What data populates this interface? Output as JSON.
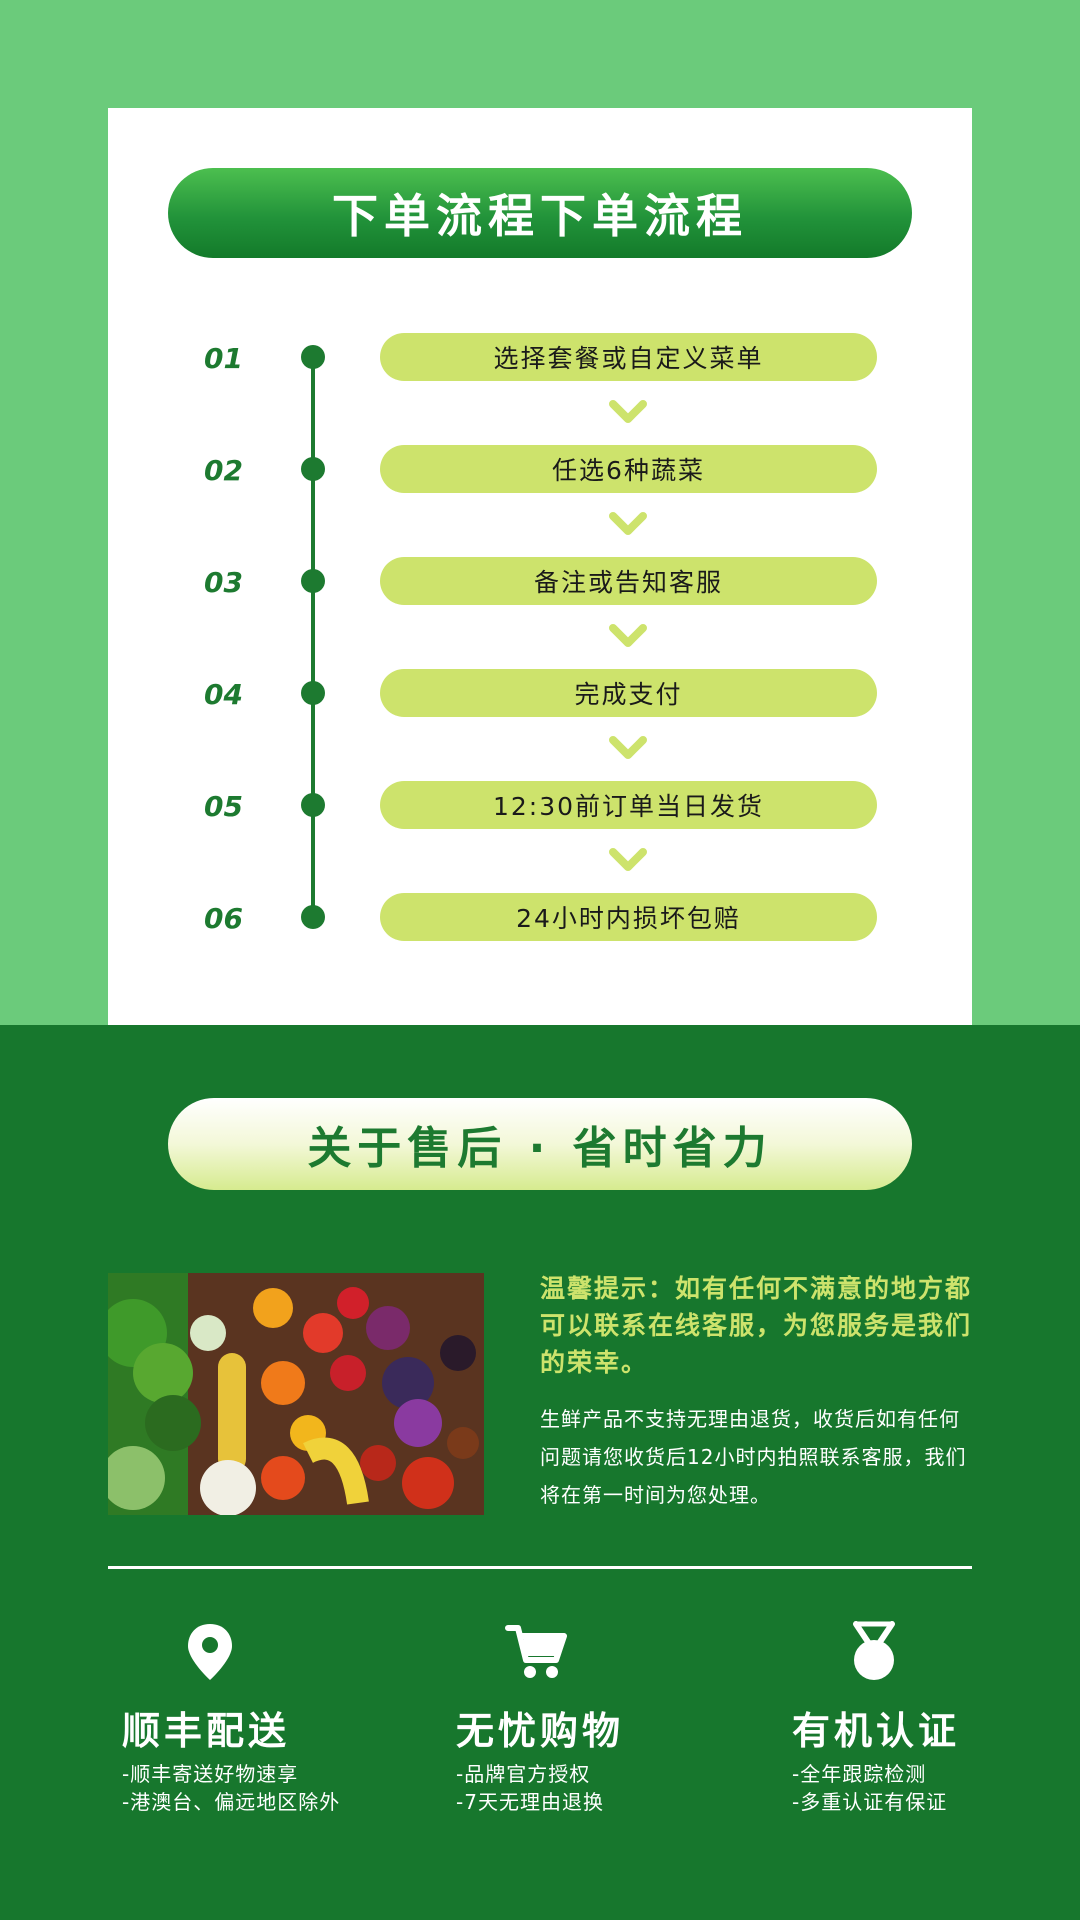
{
  "colors": {
    "light_green": "#6bcb7b",
    "dark_green": "#17772d",
    "lime": "#cde36c",
    "white": "#ffffff"
  },
  "process": {
    "title": "下单流程下单流程",
    "steps": [
      {
        "num": "01",
        "label": "选择套餐或自定义菜单"
      },
      {
        "num": "02",
        "label": "任选6种蔬菜"
      },
      {
        "num": "03",
        "label": "备注或告知客服"
      },
      {
        "num": "04",
        "label": "完成支付"
      },
      {
        "num": "05",
        "label": "12:30前订单当日发货"
      },
      {
        "num": "06",
        "label": "24小时内损坏包赔"
      }
    ]
  },
  "aftersale": {
    "title": "关于售后 · 省时省力",
    "tip_title": "温馨提示：如有任何不满意的地方都可以联系在线客服，为您服务是我们的荣幸。",
    "tip_body": "生鲜产品不支持无理由退货，收货后如有任何问题请您收货后12小时内拍照联系客服，我们将在第一时间为您处理。"
  },
  "features": [
    {
      "icon": "location-pin-icon",
      "title": "顺丰配送",
      "lines": [
        "-顺丰寄送好物速享",
        "-港澳台、偏远地区除外"
      ]
    },
    {
      "icon": "shopping-cart-icon",
      "title": "无忧购物",
      "lines": [
        "-品牌官方授权",
        "-7天无理由退换"
      ]
    },
    {
      "icon": "medal-icon",
      "title": "有机认证",
      "lines": [
        "-全年跟踪检测",
        "-多重认证有保证"
      ]
    }
  ]
}
